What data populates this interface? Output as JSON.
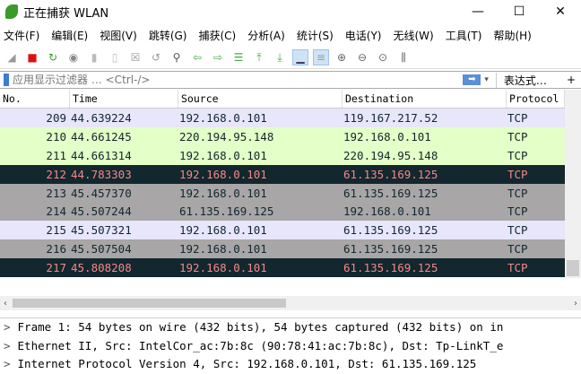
{
  "window": {
    "title": "正在捕获 WLAN",
    "minimize": "—",
    "maximize": "☐",
    "close": "✕"
  },
  "menu": [
    "文件(F)",
    "编辑(E)",
    "视图(V)",
    "跳转(G)",
    "捕获(C)",
    "分析(A)",
    "统计(S)",
    "电话(Y)",
    "无线(W)",
    "工具(T)",
    "帮助(H)"
  ],
  "toolbar": [
    "shark-fin-icon",
    "stop-icon",
    "restart-icon",
    "options-icon",
    "open-icon",
    "save-icon",
    "close-file-icon",
    "reload-icon",
    "find-icon",
    "back-icon",
    "forward-icon",
    "goto-icon",
    "first-icon",
    "last-icon",
    "autoscroll-icon",
    "colorize-icon",
    "zoom-in-icon",
    "zoom-out-icon",
    "zoom-reset-icon",
    "resize-columns-icon"
  ],
  "filter": {
    "placeholder": "应用显示过滤器 … <Ctrl-/>",
    "expression": "表达式…",
    "plus": "+",
    "apply": "➡"
  },
  "columns": [
    "No.",
    "Time",
    "Source",
    "Destination",
    "Protocol"
  ],
  "rows": [
    {
      "no": "209",
      "time": "44.639224",
      "src": "192.168.0.101",
      "dst": "119.167.217.52",
      "proto": "TCP",
      "bg": "#e7e6fb",
      "fg": "#12272e"
    },
    {
      "no": "210",
      "time": "44.661245",
      "src": "220.194.95.148",
      "dst": "192.168.0.101",
      "proto": "TCP",
      "bg": "#e4ffc7",
      "fg": "#12272e"
    },
    {
      "no": "211",
      "time": "44.661314",
      "src": "192.168.0.101",
      "dst": "220.194.95.148",
      "proto": "TCP",
      "bg": "#e4ffc7",
      "fg": "#12272e"
    },
    {
      "no": "212",
      "time": "44.783303",
      "src": "192.168.0.101",
      "dst": "61.135.169.125",
      "proto": "TCP",
      "bg": "#12272e",
      "fg": "#f78787"
    },
    {
      "no": "213",
      "time": "45.457370",
      "src": "192.168.0.101",
      "dst": "61.135.169.125",
      "proto": "TCP",
      "bg": "#a8a6a6",
      "fg": "#12272e"
    },
    {
      "no": "214",
      "time": "45.507244",
      "src": "61.135.169.125",
      "dst": "192.168.0.101",
      "proto": "TCP",
      "bg": "#a8a6a6",
      "fg": "#12272e"
    },
    {
      "no": "215",
      "time": "45.507321",
      "src": "192.168.0.101",
      "dst": "61.135.169.125",
      "proto": "TCP",
      "bg": "#e7e6fb",
      "fg": "#12272e"
    },
    {
      "no": "216",
      "time": "45.507504",
      "src": "192.168.0.101",
      "dst": "61.135.169.125",
      "proto": "TCP",
      "bg": "#a8a6a6",
      "fg": "#12272e"
    },
    {
      "no": "217",
      "time": "45.808208",
      "src": "192.168.0.101",
      "dst": "61.135.169.125",
      "proto": "TCP",
      "bg": "#12272e",
      "fg": "#f78787"
    }
  ],
  "details": [
    "Frame 1: 54 bytes on wire (432 bits), 54 bytes captured (432 bits) on in",
    "Ethernet II, Src: IntelCor_ac:7b:8c (90:78:41:ac:7b:8c), Dst: Tp-LinkT_e",
    "Internet Protocol Version 4, Src: 192.168.0.101, Dst: 61.135.169.125"
  ]
}
